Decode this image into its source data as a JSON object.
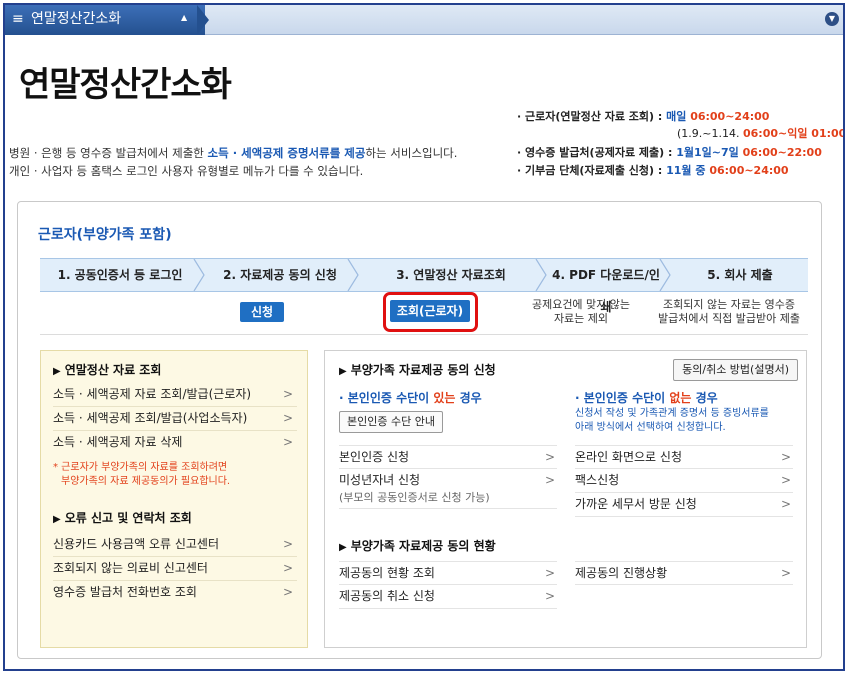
{
  "menu": {
    "title": "연말정산간소화",
    "hamburger_glyph": "≡",
    "caret_glyph": "▲",
    "collapse_glyph": "▼"
  },
  "header": {
    "title": "연말정산간소화",
    "desc1_pre": "병원 · 은행 등 영수증 발급처에서 제출한 ",
    "desc1_hl": "소득 · 세액공제 증명서류를 제공",
    "desc1_post": "하는 서비스입니다.",
    "desc2": "개인 · 사업자 등 홈택스 로그인 사용자 유형별로 메뉴가 다를 수 있습니다."
  },
  "schedule": {
    "row1_label": "· 근로자(연말정산 자료 조회) : ",
    "row1_blue": "매일 ",
    "row1_red": "06:00~24:00",
    "row1b_pre": "(1.9.~1.14. ",
    "row1b_red": "06:00~익일 01:00",
    "row1b_post": ")",
    "row2_label": "· 영수증 발급처(공제자료 제출) : ",
    "row2_blue": "1월1일~7일 ",
    "row2_red": "06:00~22:00",
    "row3_label": "· 기부금 단체(자료제출 신청) : ",
    "row3_blue": "11월 중 ",
    "row3_red": "06:00~24:00"
  },
  "panel": {
    "title": "근로자(부양가족 포함)",
    "steps": [
      {
        "label": "1. 공동인증서 등 로그인"
      },
      {
        "label": "2. 자료제공 동의 신청"
      },
      {
        "label": "3. 연말정산 자료조회"
      },
      {
        "label": "4. PDF 다운로드/인쇄"
      },
      {
        "label": "5. 회사 제출"
      }
    ],
    "apply_label": "신청",
    "query_label": "조회(근로자)",
    "sub4_line1": "공제요건에 맞지 않는",
    "sub4_line2": "자료는 제외",
    "sub5_line1": "조회되지 않는 자료는 영수증",
    "sub5_line2": "발급처에서 직접 발급받아 제출"
  },
  "left": {
    "sec1_title": "연말정산 자료 조회",
    "sec1_items": [
      "소득 · 세액공제 자료 조회/발급(근로자)",
      "소득 · 세액공제 조회/발급(사업소득자)",
      "소득 · 세액공제 자료 삭제"
    ],
    "note_line1": "* 근로자가 부양가족의 자료를 조회하려면",
    "note_line2": "부양가족의 자료 제공동의가 필요합니다.",
    "sec2_title": "오류 신고 및 연락처 조회",
    "sec2_items": [
      "신용카드 사용금액 오류 신고센터",
      "조회되지 않는 의료비 신고센터",
      "영수증 발급처 전화번호 조회"
    ]
  },
  "right": {
    "sec1_title": "부양가족 자료제공 동의 신청",
    "guide_button": "동의/취소 방법(설명서)",
    "auth_yes_pre": "· 본인인증 수단이 ",
    "auth_yes_red": "있는",
    "auth_yes_post": " 경우",
    "auth_guide_button": "본인인증 수단 안내",
    "auth_no_pre": "· 본인인증 수단이 ",
    "auth_no_red": "없는",
    "auth_no_post": " 경우",
    "auth_no_note1": "신청서 작성 및 가족관계 증명서 등 증빙서류를",
    "auth_no_note2": "아래 방식에서 선택하여 신청합니다.",
    "left_items": [
      "본인인증 신청",
      "미성년자녀 신청"
    ],
    "minor_sub": "(부모의 공동인증서로 신청 가능)",
    "right_items": [
      "온라인 화면으로 신청",
      "팩스신청",
      "가까운 세무서 방문 신청"
    ],
    "sec2_title": "부양가족 자료제공 동의 현황",
    "status_left": [
      "제공동의 현황 조회",
      "제공동의 취소 신청"
    ],
    "status_right": [
      "제공동의 진행상황"
    ]
  },
  "colors": {
    "accent_blue": "#1a59b3",
    "accent_red": "#e2401a",
    "button_blue": "#1f6fc3",
    "highlight_ring": "#e01010"
  }
}
